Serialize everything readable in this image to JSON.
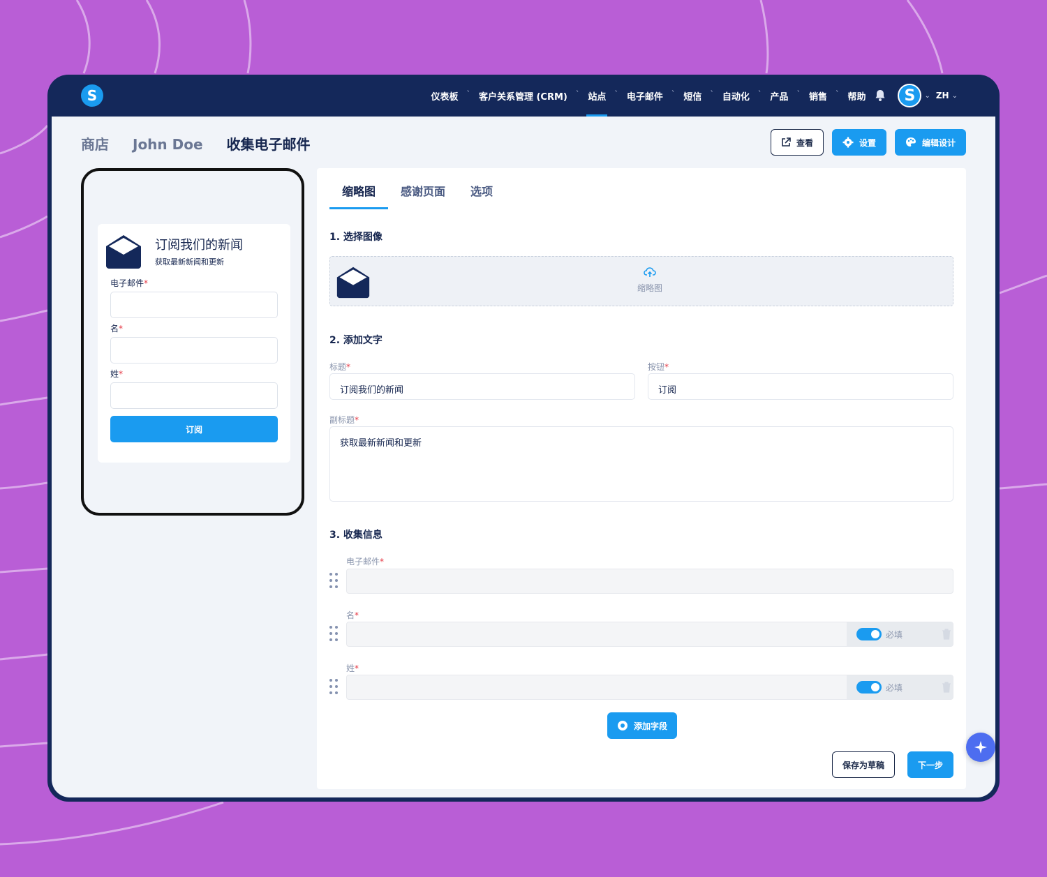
{
  "nav": {
    "items": [
      {
        "label": "仪表板",
        "active": false
      },
      {
        "label": "客户关系管理 (CRM)",
        "active": false
      },
      {
        "label": "站点",
        "active": true
      },
      {
        "label": "电子邮件",
        "active": false
      },
      {
        "label": "短信",
        "active": false
      },
      {
        "label": "自动化",
        "active": false
      },
      {
        "label": "产品",
        "active": false
      },
      {
        "label": "销售",
        "active": false
      },
      {
        "label": "帮助",
        "active": false
      }
    ],
    "sep": "`",
    "logo_letter": "S",
    "avatar_letter": "S",
    "lang": "ZH"
  },
  "breadcrumb": [
    "商店",
    "John Doe",
    "收集电子邮件"
  ],
  "actions": {
    "view": "查看",
    "settings": "设置",
    "edit_design": "编辑设计"
  },
  "preview": {
    "title": "订阅我们的新闻",
    "subtitle": "获取最新新闻和更新",
    "fields": [
      "电子邮件",
      "名",
      "姓"
    ],
    "required_mark": "*",
    "button": "订阅"
  },
  "tabs": [
    {
      "label": "缩略图",
      "active": true
    },
    {
      "label": "感谢页面",
      "active": false
    },
    {
      "label": "选项",
      "active": false
    }
  ],
  "sections": {
    "image": "1. 选择图像",
    "text": "2. 添加文字",
    "collect": "3. 收集信息"
  },
  "dropzone": {
    "label": "缩略图"
  },
  "text_form": {
    "title_label": "标题",
    "title_value": "订阅我们的新闻",
    "button_label": "按钮",
    "button_value": "订阅",
    "subtitle_label": "副标题",
    "subtitle_value": "获取最新新闻和更新"
  },
  "collect_fields": [
    {
      "label": "电子邮件",
      "required_toggle": false
    },
    {
      "label": "名",
      "required_toggle": true
    },
    {
      "label": "姓",
      "required_toggle": true
    }
  ],
  "required_text": "必填",
  "add_field": "添加字段",
  "footer": {
    "save_draft": "保存为草稿",
    "next": "下一步"
  },
  "colors": {
    "accent": "#1a9bf0",
    "navy": "#14285a",
    "background": "#b95ed6"
  }
}
